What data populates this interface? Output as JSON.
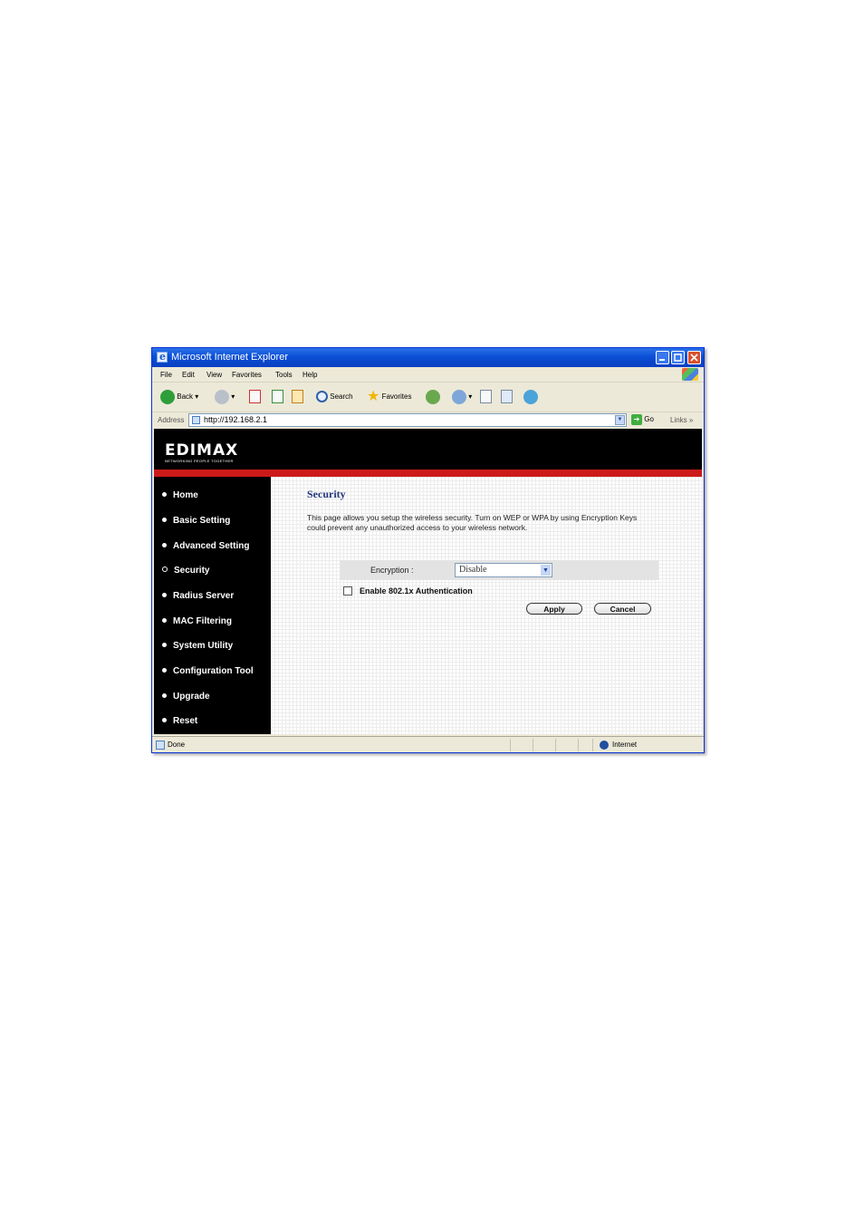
{
  "window": {
    "title": "Microsoft Internet Explorer"
  },
  "menu": [
    "File",
    "Edit",
    "View",
    "Favorites",
    "Tools",
    "Help"
  ],
  "toolbar": {
    "back": "Back",
    "search": "Search",
    "favorites": "Favorites"
  },
  "address": {
    "label": "Address",
    "url": "http://192.168.2.1",
    "go": "Go",
    "links": "Links"
  },
  "brand": {
    "logo": "EDIMAX",
    "tagline": "NETWORKING PEOPLE TOGETHER"
  },
  "sidebar": {
    "items": [
      {
        "label": "Home"
      },
      {
        "label": "Basic Setting"
      },
      {
        "label": "Advanced Setting"
      },
      {
        "label": "Security"
      },
      {
        "label": "Radius Server"
      },
      {
        "label": "MAC Filtering"
      },
      {
        "label": "System Utility"
      },
      {
        "label": "Configuration Tool"
      },
      {
        "label": "Upgrade"
      },
      {
        "label": "Reset"
      }
    ]
  },
  "main": {
    "title": "Security",
    "description": "This page allows you setup the wireless security. Turn on WEP or WPA by using Encryption Keys could prevent any unauthorized access to your wireless network.",
    "encryption_label": "Encryption :",
    "encryption_value": "Disable",
    "checkbox_label": "Enable 802.1x Authentication",
    "apply": "Apply",
    "cancel": "Cancel"
  },
  "status": {
    "text": "Done",
    "zone": "Internet"
  }
}
